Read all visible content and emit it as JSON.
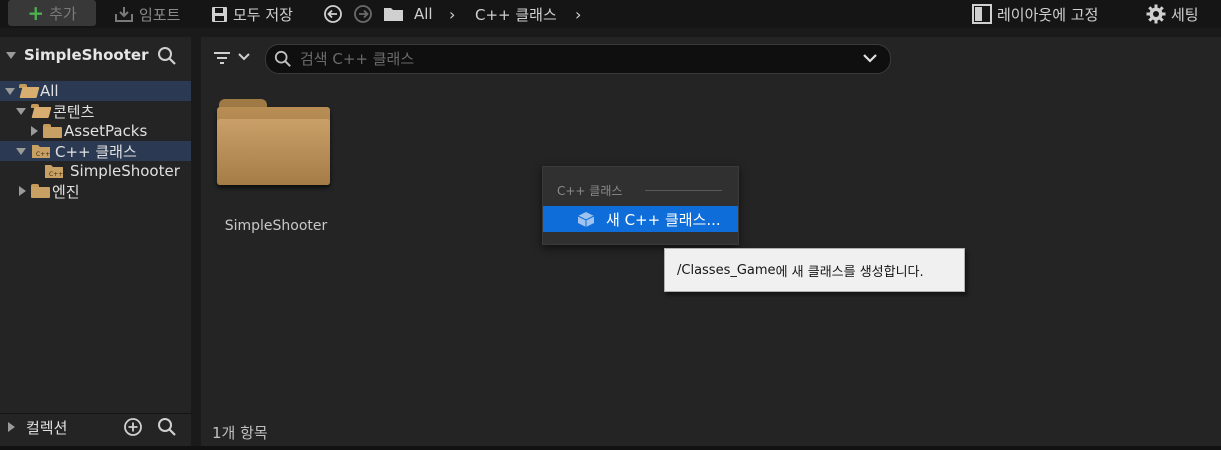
{
  "toolbar": {
    "add_label": "추가",
    "import_label": "임포트",
    "save_all_label": "모두 저장",
    "breadcrumb": [
      "All",
      "C++ 클래스"
    ],
    "lock_layout_label": "레이아웃에 고정",
    "settings_label": "세팅"
  },
  "sidebar": {
    "title": "SimpleShooter",
    "tree": [
      {
        "label": "All"
      },
      {
        "label": "콘텐츠"
      },
      {
        "label": "AssetPacks"
      },
      {
        "label": "C++ 클래스"
      },
      {
        "label": "SimpleShooter"
      },
      {
        "label": "엔진"
      }
    ],
    "collections_label": "컬렉션"
  },
  "search": {
    "placeholder": "검색 C++ 클래스"
  },
  "content": {
    "items": [
      {
        "label": "SimpleShooter"
      }
    ],
    "status": "1개 항목"
  },
  "context_menu": {
    "section": "C++ 클래스",
    "items": [
      {
        "label": "새 C++ 클래스..."
      }
    ]
  },
  "tooltip": {
    "path": "/Classes_Game",
    "text": "에 새 클래스를 생성합니다."
  },
  "colors": {
    "accent": "#0f6dd9",
    "selection": "#2b3a52",
    "folder": "#c8a064",
    "add_plus": "#4caf50"
  }
}
